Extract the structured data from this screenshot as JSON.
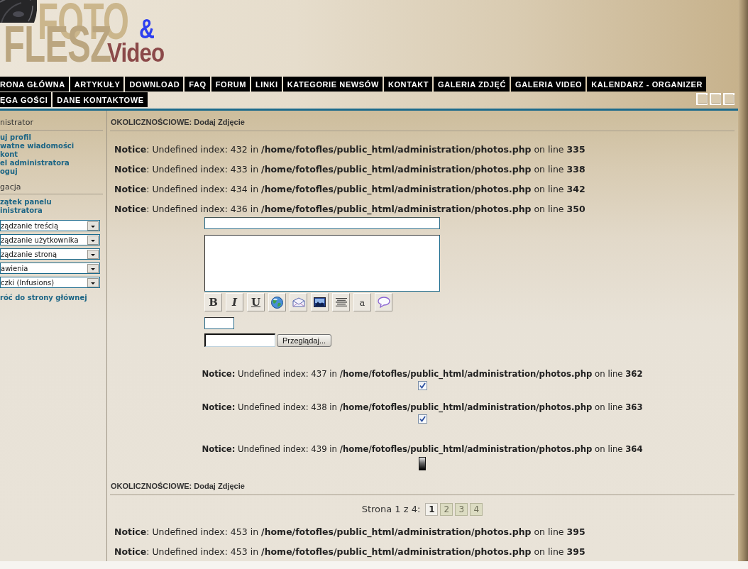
{
  "header": {
    "logo": {
      "word_1": "FOTO",
      "word_2": "FLESZ",
      "ampersand": "&",
      "word_3": "Video"
    }
  },
  "nav": {
    "rows": [
      [
        "RONA GŁÓWNA",
        "ARTYKUŁY",
        "DOWNLOAD",
        "FAQ",
        "FORUM",
        "LINKI",
        "KATEGORIE NEWSÓW",
        "KONTAKT",
        "GALERIA ZDJĘĆ",
        "GALERIA VIDEO",
        "KALENDARZ - ORGANIZER"
      ],
      [
        "ĘGA GOŚCI",
        "DANE KONTAKTOWE"
      ]
    ]
  },
  "sidebar": {
    "sections": [
      {
        "heading": "nistrator",
        "items": [
          {
            "kind": "link",
            "label": "uj profil"
          },
          {
            "kind": "link",
            "label": "watne wiadomości"
          },
          {
            "kind": "link",
            "label": "kont"
          },
          {
            "kind": "link",
            "label": "el administratora"
          },
          {
            "kind": "link",
            "label": "oguj"
          }
        ]
      },
      {
        "heading": "gacja",
        "items": [
          {
            "kind": "link",
            "label": "zątek panelu\ninistratora"
          },
          {
            "kind": "select",
            "value": "ządzanie treścią"
          },
          {
            "kind": "select",
            "value": "ządzanie użytkownika"
          },
          {
            "kind": "select",
            "value": "ządzanie stroną"
          },
          {
            "kind": "select",
            "value": "awienia"
          },
          {
            "kind": "select",
            "value": "czki (Infusions)"
          },
          {
            "kind": "link",
            "label": "róć do strony głównej"
          }
        ]
      }
    ]
  },
  "content": {
    "title": "OKOLICZNOŚCIOWE: Dodaj Zdjęcie",
    "notices_top": [
      "**Notice**: Undefined index: 432 in **/home/fotofles/public_html/administration/photos.php** on line **335**",
      "**Notice**: Undefined index: 433 in **/home/fotofles/public_html/administration/photos.php** on line **338**",
      "**Notice**: Undefined index: 434 in **/home/fotofles/public_html/administration/photos.php** on line **342**",
      "**Notice**: Undefined index: 436 in **/home/fotofles/public_html/administration/photos.php** on line **350**"
    ],
    "form": {
      "toolbar": [
        {
          "kind": "bold",
          "label": "B"
        },
        {
          "kind": "italic",
          "label": "I"
        },
        {
          "kind": "underline",
          "label": "U"
        },
        {
          "kind": "icon"
        },
        {
          "kind": "icon"
        },
        {
          "kind": "icon"
        },
        {
          "kind": "icon"
        },
        {
          "kind": "plain",
          "label": "a"
        },
        {
          "kind": "icon"
        }
      ],
      "browse_button": "Przeglądaj..."
    },
    "centered_notices": [
      {
        "text": "**Notice:** Undefined index: 437 in **/home/fotofles/public_html/administration/photos.php** on line **362**",
        "control": {
          "kind": "checkbox",
          "checked": true
        }
      },
      {
        "text": "**Notice:** Undefined index: 438 in **/home/fotofles/public_html/administration/photos.php** on line **363**",
        "control": {
          "kind": "checkbox",
          "checked": true
        }
      },
      {
        "text": "**Notice:** Undefined index: 439 in **/home/fotofles/public_html/administration/photos.php** on line **364**",
        "control": {
          "kind": "swatch"
        }
      }
    ],
    "footer_title": "OKOLICZNOŚCIOWE: Dodaj Zdjęcie",
    "pagination": {
      "label": "Strona 1 z 4:",
      "pages": [
        {
          "label": "1",
          "selected": true
        },
        {
          "label": "2",
          "selected": false
        },
        {
          "label": "3",
          "selected": false
        },
        {
          "label": "4",
          "selected": false
        }
      ]
    },
    "notices_bottom": [
      "**Notice**: Undefined index: 453 in **/home/fotofles/public_html/administration/photos.php** on line **395**",
      "**Notice**: Undefined index: 453 in **/home/fotofles/public_html/administration/photos.php** on line **395**"
    ]
  }
}
